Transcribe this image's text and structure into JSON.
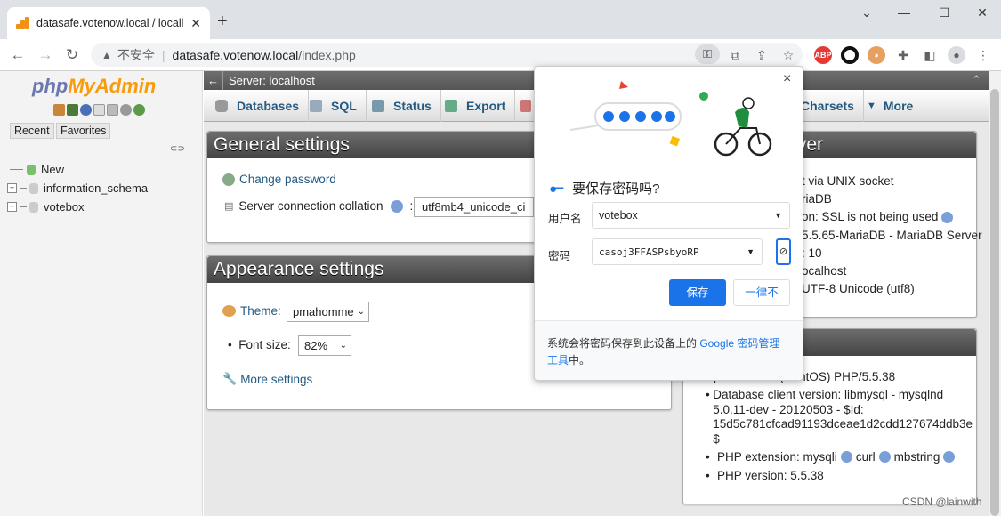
{
  "browser": {
    "tab_title": "datasafe.votenow.local / locall",
    "tab_close": "✕",
    "new_tab": "+",
    "not_secure": "不安全",
    "url_host": "datasafe.votenow.local",
    "url_path": "/index.php"
  },
  "pma": {
    "logo_php": "php",
    "logo_myadmin": "MyAdmin",
    "recent_label": "Recent",
    "favorites_label": "Favorites",
    "tree": [
      "New",
      "information_schema",
      "votebox"
    ],
    "server_title": "Server: localhost",
    "menu": [
      "Databases",
      "SQL",
      "Status",
      "Export",
      "Charsets",
      "More"
    ],
    "general": {
      "title": "General settings",
      "change_password": "Change password",
      "collation_label": "Server connection collation",
      "collation_value": "utf8mb4_unicode_ci"
    },
    "appearance": {
      "title": "Appearance settings",
      "theme_label": "Theme:",
      "theme_value": "pmahomme",
      "font_label": "Font size:",
      "font_value": "82%",
      "more_settings": "More settings"
    },
    "db_server_title_partial": "ver",
    "db_server_lines": [
      "t via UNIX socket",
      "riaDB",
      "on: SSL is not being used",
      "5.5.65-MariaDB - MariaDB Server",
      ": 10",
      "ocalhost",
      "UTF-8 Unicode (utf8)"
    ],
    "web_server_lines": [
      "Apache/2.4.6 (CentOS) PHP/5.5.38",
      "Database client version: libmysql - mysqlnd 5.0.11-dev - 20120503 - $Id: 15d5c781cfcad91193dceae1d2cdd127674ddb3e $",
      "PHP extension: mysqli",
      "curl",
      "mbstring",
      "PHP version: 5.5.38"
    ]
  },
  "password_popup": {
    "title": "要保存密码吗?",
    "username_label": "用户名",
    "username_value": "votebox",
    "password_label": "密码",
    "password_value": "casoj3FFASPsbyoRP",
    "save_button": "保存",
    "never_button": "一律不",
    "footer_text": "系统会将密码保存到此设备上的 ",
    "footer_link": "Google 密码管理工具",
    "footer_end": "中。",
    "close": "×"
  },
  "watermark": "CSDN @lainwith",
  "colors": {
    "accent": "#1a73e8",
    "pma_link": "#235a81",
    "pma_orange": "#f89c0e"
  }
}
